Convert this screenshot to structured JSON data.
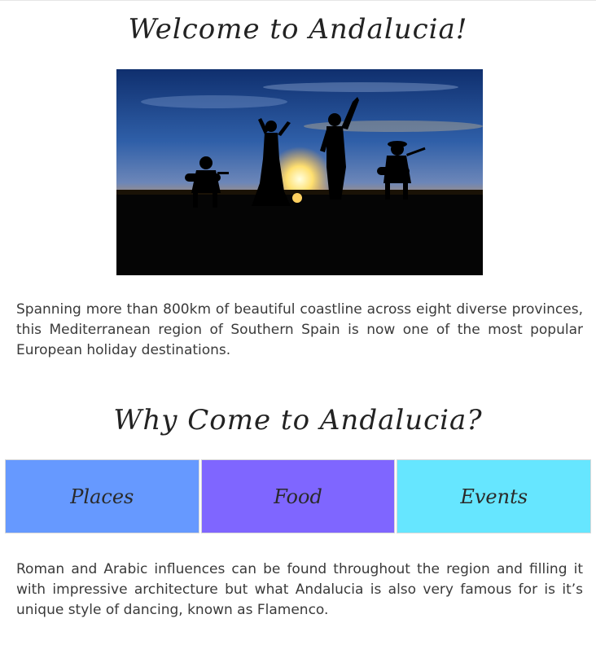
{
  "welcome": {
    "title": "Welcome to Andalucia!"
  },
  "hero": {
    "icon": "flamenco-sunset-photo"
  },
  "intro": {
    "text": "Spanning more than 800km of beautiful coastline across eight diverse provinces, this Mediterranean region of Southern Spain is now one of the most popular European holiday destinations."
  },
  "why": {
    "title": "Why Come to Andalucia?"
  },
  "tiles": [
    {
      "label": "Places",
      "color": "#6699ff"
    },
    {
      "label": "Food",
      "color": "#7f66ff"
    },
    {
      "label": "Events",
      "color": "#66e6ff"
    }
  ],
  "dance": {
    "text": "Roman and Arabic influences can be found throughout the region and filling it with impressive architecture but what Andalucia is also very famous for is it’s unique style of dancing, known as Flamenco."
  }
}
